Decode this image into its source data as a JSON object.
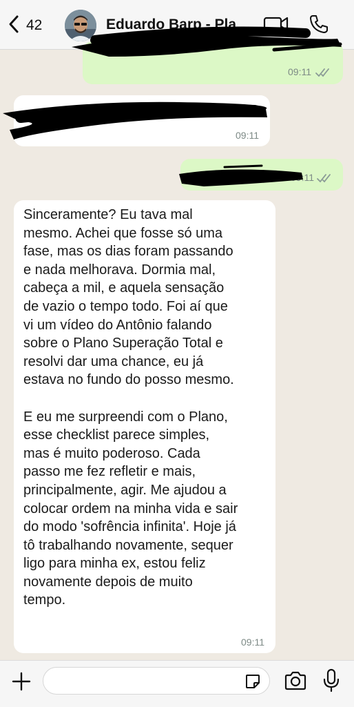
{
  "header": {
    "back_count": "42",
    "contact_name": "Eduardo Barp - Plano Superação Total",
    "icons": [
      "chevron-left-icon",
      "video-camera-icon",
      "phone-icon"
    ]
  },
  "messages": [
    {
      "direction": "outgoing",
      "time": "09:11",
      "status": "read",
      "content_redacted": true
    },
    {
      "direction": "incoming",
      "time": "09:11",
      "content_redacted": true
    },
    {
      "direction": "outgoing",
      "time": "09:11",
      "status": "read",
      "content_redacted": true
    },
    {
      "direction": "incoming",
      "time": "09:11",
      "text": "Sinceramente? Eu tava mal\nmesmo. Achei que fosse só uma\nfase, mas os dias foram passando\ne nada melhorava. Dormia mal,\ncabeça a mil, e aquela sensação\nde vazio o tempo todo. Foi aí que\nvi um vídeo do Antônio falando\nsobre o Plano Superação Total e\nresolvi dar uma chance, eu já\nestava no fundo do posso mesmo.\n\nE eu me surpreendi com o Plano,\nesse checklist parece simples,\nmas é muito poderoso. Cada\npasso me fez refletir e mais,\nprincipalmente, agir. Me ajudou a\ncolocar ordem na minha vida e sair\ndo modo 'sofrência infinita'. Hoje já\ntô trabalhando novamente, sequer\nligo para minha ex, estou feliz\nnovamente depois de muito\ntempo."
    }
  ],
  "composer": {
    "message_value": "",
    "icons": [
      "plus-icon",
      "sticker-icon",
      "camera-icon",
      "microphone-icon"
    ]
  },
  "colors": {
    "chat_background": "#efeae2",
    "outgoing_bubble": "#dcf8c6",
    "incoming_bubble": "#ffffff",
    "read_ticks": "#8a9a96",
    "header_background": "#f6f6f6"
  }
}
